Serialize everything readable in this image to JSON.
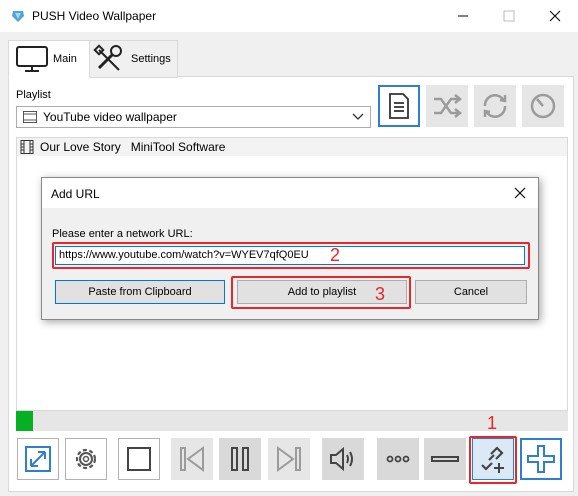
{
  "window": {
    "title": "PUSH Video Wallpaper"
  },
  "tabs": [
    {
      "label": "Main"
    },
    {
      "label": "Settings"
    }
  ],
  "playlist": {
    "label": "Playlist",
    "selected": "YouTube video wallpaper"
  },
  "list": {
    "items": [
      {
        "label": "Our Love Story   MiniTool Software"
      }
    ]
  },
  "progress": {
    "fraction": 0.03
  },
  "dialog": {
    "title": "Add URL",
    "prompt": "Please enter a network URL:",
    "url_value": "https://www.youtube.com/watch?v=WYEV7qfQ0EU",
    "paste_label": "Paste from Clipboard",
    "add_label": "Add to playlist",
    "cancel_label": "Cancel"
  },
  "annotations": {
    "step1": "1",
    "step2": "2",
    "step3": "3"
  },
  "colors": {
    "accent": "#2f7fd1",
    "highlight": "#e8272b",
    "progress": "#06b025"
  },
  "icons": {
    "top_toolbar": [
      "playlist-document-icon",
      "shuffle-icon",
      "repeat-icon",
      "timer-icon"
    ],
    "bottom_toolbar": [
      "fullscreen-icon",
      "gear-icon",
      "stop-icon",
      "previous-icon",
      "pause-icon",
      "next-icon",
      "volume-icon",
      "more-icon",
      "remove-icon",
      "add-url-icon",
      "add-icon"
    ]
  }
}
